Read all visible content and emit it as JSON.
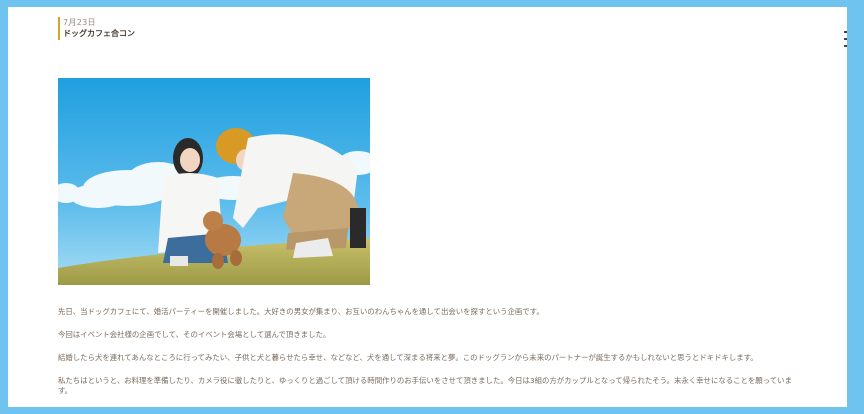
{
  "post": {
    "date": "7月23日",
    "title": "ドッグカフェ合コン"
  },
  "hero_image": {
    "alt": "Couple with a toy poodle on a grassy hill under a blue sky"
  },
  "paragraphs": [
    "先日、当ドッグカフェにて、婚活パーティーを開催しました。大好きの男女が集まり、お互いのわんちゃんを通して出会いを探すという企画です。",
    "今回はイベント会社様の企画でして、そのイベント会場として選んで頂きました。",
    "結婚したら犬を連れてあんなところに行ってみたい、子供と犬と暮らせたら幸せ、などなど、犬を通して深まる将来と夢。このドッグランから未来のパートナーが誕生するかもしれないと思うとドキドキします。",
    "私たちはというと、お料理を準備したり、カメラ役に徹したりと、ゆっくりと過ごして頂ける時間作りのお手伝いをさせて頂きました。今日は3組の方がカップルとなって帰られたそう。末永く幸せになることを願っています。"
  ],
  "colors": {
    "frame_bg": "#6ec3ef",
    "accent": "#d4a62a"
  }
}
